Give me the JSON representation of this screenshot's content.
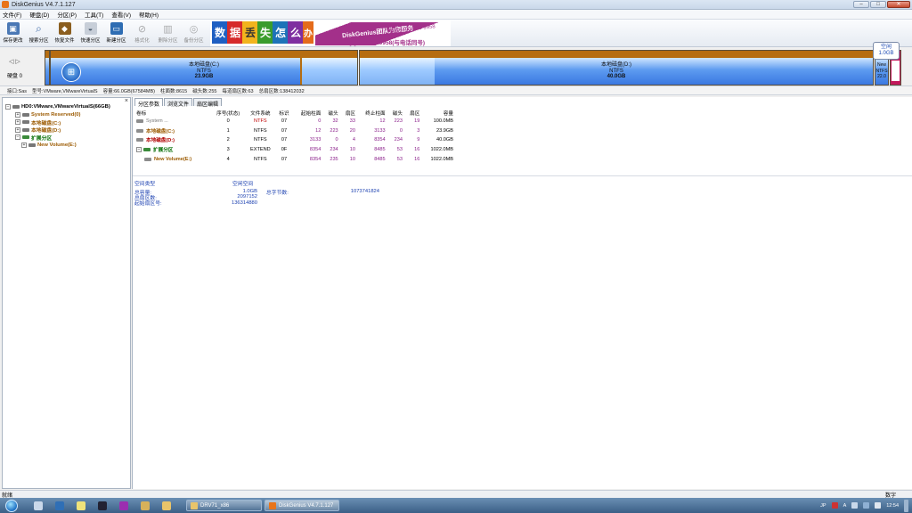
{
  "window": {
    "title": "DiskGenius V4.7.1.127",
    "min": "–",
    "max": "□",
    "close": "✕"
  },
  "menu": [
    "文件(F)",
    "硬盘(D)",
    "分区(P)",
    "工具(T)",
    "查看(V)",
    "帮助(H)"
  ],
  "toolbar": [
    {
      "label": "保存更改",
      "icon": "save-icon",
      "disabled": false,
      "color": "#4a78b5"
    },
    {
      "label": "搜索分区",
      "icon": "search-icon",
      "disabled": false,
      "color": "#3d6aa8"
    },
    {
      "label": "恢复文件",
      "icon": "recover-icon",
      "disabled": false,
      "color": "#8b5e1f"
    },
    {
      "label": "快速分区",
      "icon": "quick-partition-icon",
      "disabled": false,
      "color": "#6d7f94"
    },
    {
      "label": "新建分区",
      "icon": "new-partition-icon",
      "disabled": false,
      "color": "#2e6db3"
    },
    {
      "label": "格式化",
      "icon": "format-icon",
      "disabled": true,
      "color": "#777777"
    },
    {
      "label": "删除分区",
      "icon": "delete-icon",
      "disabled": true,
      "color": "#777777"
    },
    {
      "label": "备份分区",
      "icon": "backup-icon",
      "disabled": true,
      "color": "#777777"
    }
  ],
  "banner": {
    "tiles": [
      "数",
      "据",
      "丢",
      "失",
      "怎",
      "么",
      "办"
    ],
    "brand": "DiskGenius团队为您服务",
    "phone": "电话: 400-008-9958",
    "qq": "QQ: 4000089958(与电话同号)"
  },
  "diskmap": {
    "nav": "◁ ▷",
    "disk_label": "硬盘 0",
    "partitions": [
      {
        "name": "本地磁盘(C:)",
        "fs": "NTFS",
        "size": "23.9GB"
      },
      {
        "name": "本地磁盘(D:)",
        "fs": "NTFS",
        "size": "40.0GB"
      }
    ],
    "small": {
      "name": "New",
      "fs": "NTFS",
      "size": "22.0"
    },
    "free_box": {
      "label": "空闲",
      "size": "1.0GB"
    }
  },
  "infobar": {
    "iface": "接口:Sas",
    "model": "型号:VMware,VMwareVirtualS",
    "capacity": "容量:66.0GB(67584MB)",
    "cylinders": "柱面数:8615",
    "heads": "磁头数:255",
    "sectors_per_track": "每道扇区数:63",
    "total_sectors": "总扇区数:138412032"
  },
  "tree": {
    "disk": "HD0:VMware,VMwareVirtualS(66GB)",
    "items": [
      {
        "label": "System Reserved(0)",
        "level": 1,
        "style": "brown"
      },
      {
        "label": "本地磁盘(C:)",
        "level": 1,
        "style": "brown"
      },
      {
        "label": "本地磁盘(D:)",
        "level": 1,
        "style": "brown"
      },
      {
        "label": "扩展分区",
        "level": 1,
        "style": "green"
      },
      {
        "label": "New Volume(E:)",
        "level": 2,
        "style": "brown"
      }
    ]
  },
  "tabs": [
    "分区参数",
    "浏览文件",
    "扇区编辑"
  ],
  "table": {
    "headers": [
      "卷标",
      "序号(状态)",
      "文件系统",
      "标识",
      "起始柱面",
      "磁头",
      "扇区",
      "终止柱面",
      "磁头",
      "扇区",
      "容量"
    ],
    "rows": [
      {
        "name": "System ...",
        "style": "gray",
        "num": "0",
        "fs": "NTFS",
        "id": "07",
        "sc": "0",
        "sh": "32",
        "ss": "33",
        "ec": "12",
        "eh": "223",
        "es": "19",
        "cap": "100.0MB"
      },
      {
        "name": "本地磁盘(C:)",
        "style": "brown",
        "num": "1",
        "fs": "NTFS",
        "id": "07",
        "sc": "12",
        "sh": "223",
        "ss": "20",
        "ec": "3133",
        "eh": "0",
        "es": "3",
        "cap": "23.9GB"
      },
      {
        "name": "本地磁盘(D:)",
        "style": "brown",
        "num": "2",
        "fs": "NTFS",
        "id": "07",
        "sc": "3133",
        "sh": "0",
        "ss": "4",
        "ec": "8354",
        "eh": "234",
        "es": "9",
        "cap": "40.0GB"
      },
      {
        "name": "扩展分区",
        "style": "green",
        "num": "3",
        "fs": "EXTEND",
        "id": "0F",
        "sc": "8354",
        "sh": "234",
        "ss": "10",
        "ec": "8485",
        "eh": "53",
        "es": "16",
        "cap": "1022.0MB"
      },
      {
        "name": "New Volume(E:)",
        "style": "brown",
        "num": "4",
        "fs": "NTFS",
        "id": "07",
        "sc": "8354",
        "sh": "235",
        "ss": "10",
        "ec": "8485",
        "eh": "53",
        "es": "16",
        "cap": "1022.0MB"
      }
    ]
  },
  "freeinfo": {
    "type_label": "空间类型",
    "type_value": "空闲空间",
    "total_label": "总容量:",
    "total_value": "1.0GB",
    "bytes_label": "总字节数:",
    "bytes_value": "1073741824",
    "sectors_label": "总扇区数:",
    "sectors_value": "2097152",
    "start_label": "起始扇区号:",
    "start_value": "136314880"
  },
  "status": {
    "left": "就绪",
    "right": "数字"
  },
  "taskbar": {
    "buttons": [
      "DRV71_x86",
      "DiskGenius V4.7.1.127"
    ],
    "tray_lang": "JP",
    "tray_extra": "A",
    "time": "12:54"
  }
}
